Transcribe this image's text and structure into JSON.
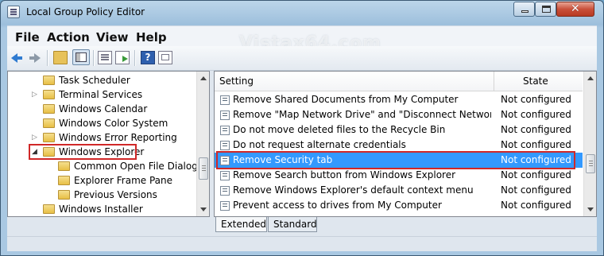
{
  "window": {
    "title": "Local Group Policy Editor"
  },
  "menu": [
    {
      "label": "File"
    },
    {
      "label": "Action"
    },
    {
      "label": "View"
    },
    {
      "label": "Help"
    }
  ],
  "watermark": "Vistax64.com",
  "tree": {
    "items": [
      {
        "label": "Task Scheduler"
      },
      {
        "label": "Terminal Services"
      },
      {
        "label": "Windows Calendar"
      },
      {
        "label": "Windows Color System"
      },
      {
        "label": "Windows Error Reporting"
      },
      {
        "label": "Windows Explorer"
      },
      {
        "label": "Common Open File Dialog"
      },
      {
        "label": "Explorer Frame Pane"
      },
      {
        "label": "Previous Versions"
      },
      {
        "label": "Windows Installer"
      }
    ],
    "highlighted": "Windows Explorer"
  },
  "list": {
    "columns": {
      "setting": "Setting",
      "state": "State"
    },
    "rows": [
      {
        "name": "Remove Shared Documents from My Computer",
        "state": "Not configured"
      },
      {
        "name": "Remove \"Map Network Drive\" and \"Disconnect Network Dri...",
        "state": "Not configured"
      },
      {
        "name": "Do not move deleted files to the Recycle Bin",
        "state": "Not configured"
      },
      {
        "name": "Do not request alternate credentials",
        "state": "Not configured"
      },
      {
        "name": "Remove Security tab",
        "state": "Not configured"
      },
      {
        "name": "Remove Search button from Windows Explorer",
        "state": "Not configured"
      },
      {
        "name": "Remove Windows Explorer's default context menu",
        "state": "Not configured"
      },
      {
        "name": "Prevent access to drives from My Computer",
        "state": "Not configured"
      }
    ],
    "selected": "Remove Security tab"
  },
  "tabs": [
    {
      "label": "Extended"
    },
    {
      "label": "Standard"
    }
  ],
  "colors": {
    "selection": "#3399ff",
    "highlight_box": "#d02828"
  }
}
